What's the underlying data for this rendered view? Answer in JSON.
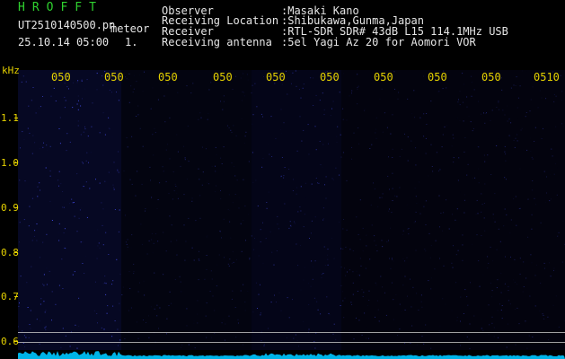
{
  "header": {
    "app_title": "HROFFT",
    "file_name": "UT2510140500.pn",
    "datetime": "25.10.14 05:00",
    "meteor_label": "meteor",
    "meteor_dash": "-",
    "meteor_count": "1.",
    "info": [
      {
        "label": "Observer",
        "value": ":Masaki Kano"
      },
      {
        "label": "Receiving Location",
        "value": ":Shibukawa,Gunma,Japan"
      },
      {
        "label": "Receiver",
        "value": ":RTL-SDR SDR# 43dB L15 114.1MHz USB"
      },
      {
        "label": "Receiving antenna",
        "value": ":5el Yagi Az 20 for Aomori VOR"
      }
    ]
  },
  "chart_data": {
    "type": "heatmap",
    "title": "",
    "y_unit_label": "kHz",
    "y_ticks": [
      "1.1",
      "1.0",
      "0.9",
      "0.8",
      "0.7",
      "0.6"
    ],
    "x_ticks": [
      "050",
      "050",
      "050",
      "050",
      "050",
      "050",
      "050",
      "050",
      "050",
      "0510"
    ],
    "colors": {
      "background": "#000000",
      "noise": "#1a1f8c",
      "signal_trace": "#00c8ff",
      "axis_text": "#e6d200",
      "guide_lines": "#c8c8c8"
    }
  }
}
